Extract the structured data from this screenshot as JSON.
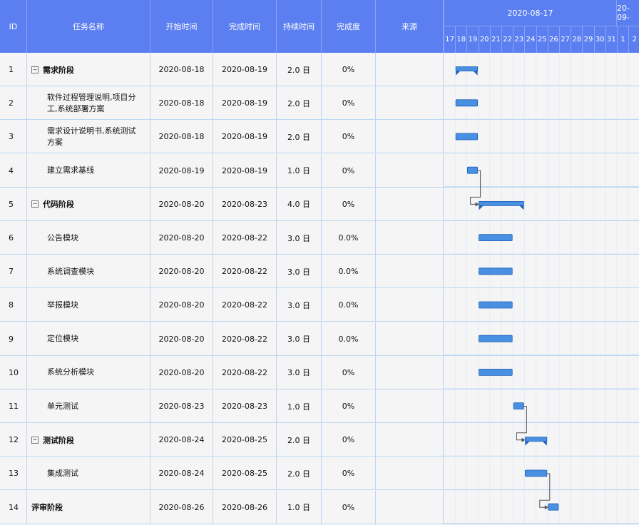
{
  "columns": {
    "id": "ID",
    "name": "任务名称",
    "start": "开始时间",
    "finish": "完成时间",
    "duration": "持续时间",
    "progress": "完成度",
    "source": "来源"
  },
  "timeline": {
    "weeks": [
      "2020-08-17",
      "20-09-"
    ],
    "days": [
      "17",
      "18",
      "19",
      "20",
      "21",
      "22",
      "23",
      "24",
      "25",
      "26",
      "27",
      "28",
      "29",
      "30",
      "31",
      "1",
      "2"
    ]
  },
  "colors": {
    "header_bg": "#5b7ff0",
    "bar": "#4a90e2",
    "summary_bar": "#4a90e2",
    "row_line": "#bcd6f4"
  },
  "tasks": [
    {
      "id": "1",
      "name": "需求阶段",
      "start": "2020-08-18",
      "finish": "2020-08-19",
      "duration": "2.0 日",
      "progress": "0%",
      "source": "",
      "summary": true,
      "collapse": "⊟"
    },
    {
      "id": "2",
      "name": "软件过程管理说明,项目分工,系统部署方案",
      "start": "2020-08-18",
      "finish": "2020-08-19",
      "duration": "2.0 日",
      "progress": "0%",
      "source": ""
    },
    {
      "id": "3",
      "name": "需求设计说明书,系统测试方案",
      "start": "2020-08-18",
      "finish": "2020-08-19",
      "duration": "2.0 日",
      "progress": "0%",
      "source": ""
    },
    {
      "id": "4",
      "name": "建立需求基线",
      "start": "2020-08-19",
      "finish": "2020-08-19",
      "duration": "1.0 日",
      "progress": "0%",
      "source": ""
    },
    {
      "id": "5",
      "name": "代码阶段",
      "start": "2020-08-20",
      "finish": "2020-08-23",
      "duration": "4.0 日",
      "progress": "0%",
      "source": "",
      "summary": true,
      "collapse": "⊟"
    },
    {
      "id": "6",
      "name": "公告模块",
      "start": "2020-08-20",
      "finish": "2020-08-22",
      "duration": "3.0 日",
      "progress": "0.0%",
      "source": ""
    },
    {
      "id": "7",
      "name": "系统调查模块",
      "start": "2020-08-20",
      "finish": "2020-08-22",
      "duration": "3.0 日",
      "progress": "0.0%",
      "source": ""
    },
    {
      "id": "8",
      "name": "举报模块",
      "start": "2020-08-20",
      "finish": "2020-08-22",
      "duration": "3.0 日",
      "progress": "0.0%",
      "source": ""
    },
    {
      "id": "9",
      "name": "定位模块",
      "start": "2020-08-20",
      "finish": "2020-08-22",
      "duration": "3.0 日",
      "progress": "0.0%",
      "source": ""
    },
    {
      "id": "10",
      "name": "系统分析模块",
      "start": "2020-08-20",
      "finish": "2020-08-22",
      "duration": "3.0 日",
      "progress": "0%",
      "source": ""
    },
    {
      "id": "11",
      "name": "单元测试",
      "start": "2020-08-23",
      "finish": "2020-08-23",
      "duration": "1.0 日",
      "progress": "0%",
      "source": ""
    },
    {
      "id": "12",
      "name": "测试阶段",
      "start": "2020-08-24",
      "finish": "2020-08-25",
      "duration": "2.0 日",
      "progress": "0%",
      "source": "",
      "summary": true,
      "collapse": "⊟"
    },
    {
      "id": "13",
      "name": "集成测试",
      "start": "2020-08-24",
      "finish": "2020-08-25",
      "duration": "2.0 日",
      "progress": "0%",
      "source": ""
    },
    {
      "id": "14",
      "name": "评审阶段",
      "start": "2020-08-26",
      "finish": "2020-08-26",
      "duration": "1.0 日",
      "progress": "0%",
      "source": "",
      "summary": true
    }
  ],
  "dependencies": [
    [
      4,
      5
    ],
    [
      11,
      12
    ],
    [
      13,
      14
    ]
  ]
}
